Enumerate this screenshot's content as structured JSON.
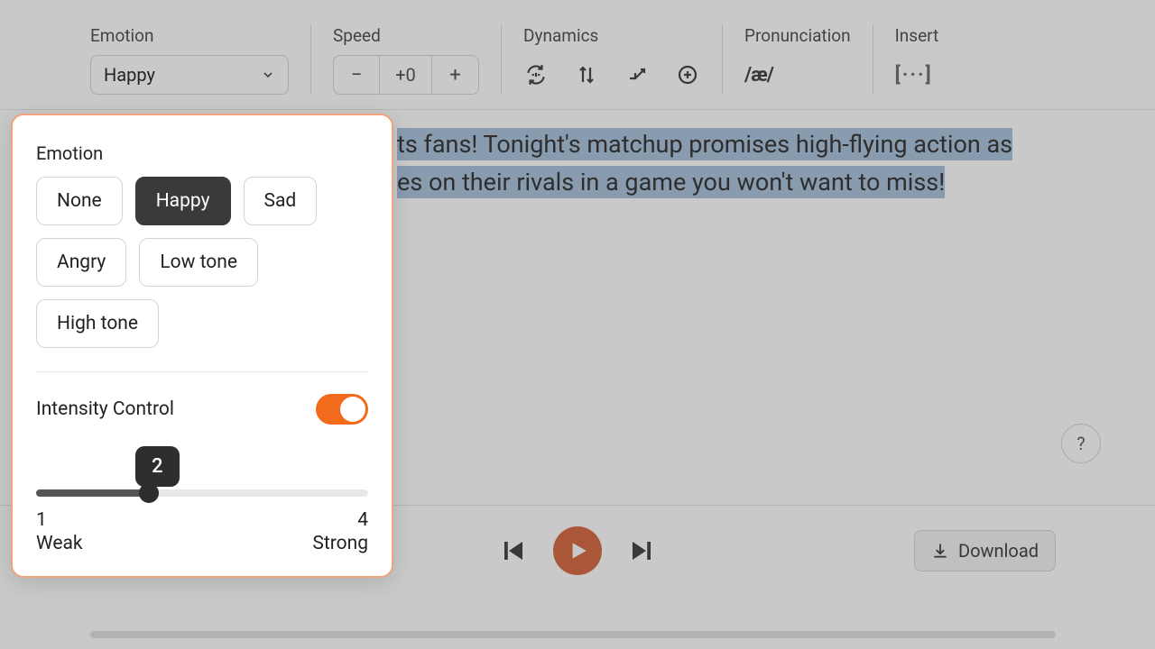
{
  "toolbar": {
    "emotion": {
      "label": "Emotion",
      "value": "Happy"
    },
    "speed": {
      "label": "Speed",
      "value": "+0",
      "minus": "−",
      "plus": "+"
    },
    "dynamics": {
      "label": "Dynamics"
    },
    "pronunciation": {
      "label": "Pronunciation",
      "glyph": "/æ/"
    },
    "insert": {
      "label": "Insert",
      "glyph": "[···]"
    }
  },
  "text": {
    "line1": "ts fans! Tonight's matchup promises high-flying action as",
    "line2": "es on their rivals in a game you won't want to miss!"
  },
  "help": "?",
  "player": {
    "download": "Download"
  },
  "popup": {
    "title": "Emotion",
    "chips": [
      "None",
      "Happy",
      "Sad",
      "Angry",
      "Low tone",
      "High tone"
    ],
    "active_index": 1,
    "intensity_label": "Intensity Control",
    "intensity_on": true,
    "slider": {
      "value": 2,
      "min": 1,
      "max": 4,
      "min_label": "Weak",
      "max_label": "Strong"
    }
  }
}
